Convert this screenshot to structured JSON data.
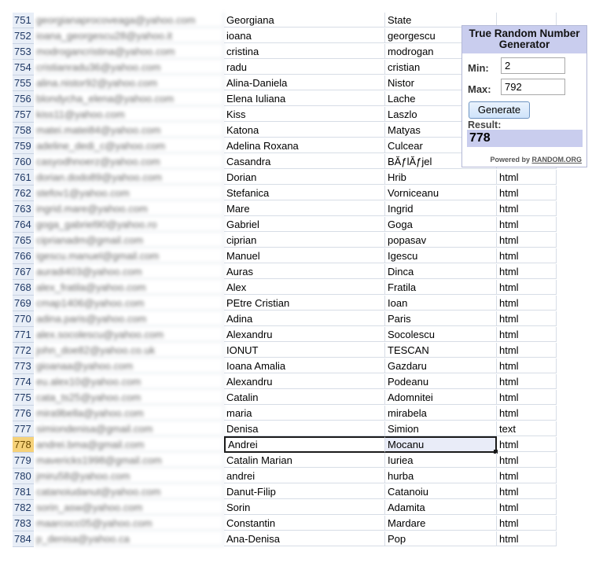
{
  "active_row": 778,
  "rows": [
    {
      "num": "751",
      "email": "georgianaprocoveaga@yahoo.com",
      "first": "Georgiana",
      "last": "State",
      "type": ""
    },
    {
      "num": "752",
      "email": "ioana_georgescu28@yahoo.it",
      "first": "ioana",
      "last": "georgescu",
      "type": ""
    },
    {
      "num": "753",
      "email": "modrogancristina@yahoo.com",
      "first": "cristina",
      "last": "modrogan",
      "type": ""
    },
    {
      "num": "754",
      "email": "cristianradu36@yahoo.com",
      "first": "radu",
      "last": "cristian",
      "type": ""
    },
    {
      "num": "755",
      "email": "alina.nistor92@yahoo.com",
      "first": "Alina-Daniela",
      "last": "Nistor",
      "type": ""
    },
    {
      "num": "756",
      "email": "blondycha_elena@yahoo.com",
      "first": "Elena Iuliana",
      "last": "Lache",
      "type": ""
    },
    {
      "num": "757",
      "email": "kiss11@yahoo.com",
      "first": "Kiss",
      "last": "Laszlo",
      "type": ""
    },
    {
      "num": "758",
      "email": "matei.matei84@yahoo.com",
      "first": "Katona",
      "last": "Matyas",
      "type": ""
    },
    {
      "num": "759",
      "email": "adeline_dedi_c@yahoo.com",
      "first": "Adelina Roxana",
      "last": "Culcear",
      "type": ""
    },
    {
      "num": "760",
      "email": "casyodhnoerz@yahoo.com",
      "first": "Casandra",
      "last": "BĂƒlĂƒjel",
      "type": ""
    },
    {
      "num": "761",
      "email": "dorian.dodo89@yahoo.com",
      "first": "Dorian",
      "last": "Hrib",
      "type": "html"
    },
    {
      "num": "762",
      "email": "stefov1@yahoo.com",
      "first": "Stefanica",
      "last": "Vorniceanu",
      "type": "html"
    },
    {
      "num": "763",
      "email": "ingrid.mare@yahoo.com",
      "first": "Mare",
      "last": "Ingrid",
      "type": "html"
    },
    {
      "num": "764",
      "email": "goga_gabriel90@yahoo.ro",
      "first": "Gabriel",
      "last": "Goga",
      "type": "html"
    },
    {
      "num": "765",
      "email": "ciprianadm@gmail.com",
      "first": "ciprian",
      "last": "popasav",
      "type": "html"
    },
    {
      "num": "766",
      "email": "igescu.manuel@gmail.com",
      "first": "Manuel",
      "last": "Igescu",
      "type": "html"
    },
    {
      "num": "767",
      "email": "auradi403@yahoo.com",
      "first": "Auras",
      "last": "Dinca",
      "type": "html"
    },
    {
      "num": "768",
      "email": "alex_fratila@yahoo.com",
      "first": "Alex",
      "last": "Fratila",
      "type": "html"
    },
    {
      "num": "769",
      "email": "cmap1406@yahoo.com",
      "first": "PEtre Cristian",
      "last": "Ioan",
      "type": "html"
    },
    {
      "num": "770",
      "email": "adina.paris@yahoo.com",
      "first": "Adina",
      "last": "Paris",
      "type": "html"
    },
    {
      "num": "771",
      "email": "alex.socolescu@yahoo.com",
      "first": "Alexandru",
      "last": "Socolescu",
      "type": "html"
    },
    {
      "num": "772",
      "email": "john_doe82@yahoo.co.uk",
      "first": "IONUT",
      "last": "TESCAN",
      "type": "html"
    },
    {
      "num": "773",
      "email": "gioanaa@yahoo.com",
      "first": "Ioana Amalia",
      "last": "Gazdaru",
      "type": "html"
    },
    {
      "num": "774",
      "email": "eu.alex10@yahoo.com",
      "first": "Alexandru",
      "last": "Podeanu",
      "type": "html"
    },
    {
      "num": "775",
      "email": "cata_ts25@yahoo.com",
      "first": "Catalin",
      "last": "Adomnitei",
      "type": "html"
    },
    {
      "num": "776",
      "email": "mira9bella@yahoo.com",
      "first": "maria",
      "last": "mirabela",
      "type": "html"
    },
    {
      "num": "777",
      "email": "simiondenisa@gmail.com",
      "first": "Denisa",
      "last": "Simion",
      "type": "text"
    },
    {
      "num": "778",
      "email": "andrei.bma@gmail.com",
      "first": "Andrei",
      "last": "Mocanu",
      "type": "html"
    },
    {
      "num": "779",
      "email": "mavericks1998@gmail.com",
      "first": "Catalin Marian",
      "last": "Iuriea",
      "type": "html"
    },
    {
      "num": "780",
      "email": "jmiru58@yahoo.com",
      "first": "andrei",
      "last": "hurba",
      "type": "html"
    },
    {
      "num": "781",
      "email": "catanoiudanut@yahoo.com",
      "first": "Danut-Filip",
      "last": "Catanoiu",
      "type": "html"
    },
    {
      "num": "782",
      "email": "sorin_asw@yahoo.com",
      "first": "Sorin",
      "last": "Adamita",
      "type": "html"
    },
    {
      "num": "783",
      "email": "maarcocc05@yahoo.com",
      "first": "Constantin",
      "last": "Mardare",
      "type": "html"
    },
    {
      "num": "784",
      "email": "p_denisa@yahoo.ca",
      "first": "Ana-Denisa",
      "last": "Pop",
      "type": "html"
    }
  ],
  "widget": {
    "title": "True Random Number Generator",
    "min_label": "Min:",
    "min_value": "2",
    "max_label": "Max:",
    "max_value": "792",
    "generate_label": "Generate",
    "result_label": "Result:",
    "result_value": "778",
    "powered_prefix": "Powered by",
    "powered_link": "RANDOM.ORG"
  },
  "colors": {
    "active_row_header": "#f6d27a",
    "row_header": "#e8eef7",
    "widget_accent": "#c9cdee"
  }
}
